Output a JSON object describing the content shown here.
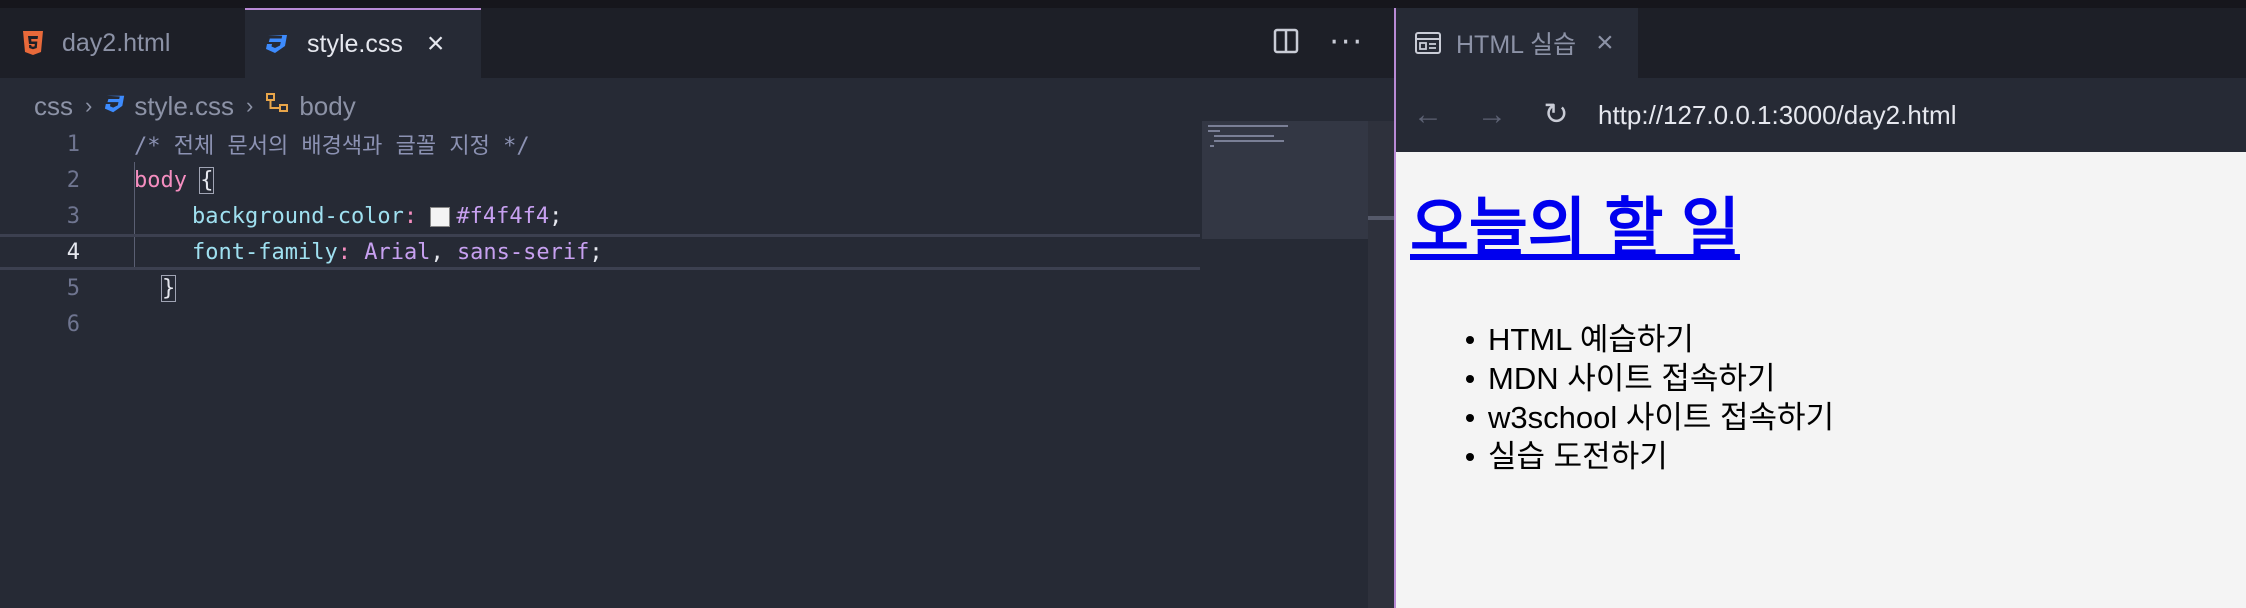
{
  "editor": {
    "tabs": [
      {
        "name": "day2.html",
        "icon": "html5-icon"
      },
      {
        "name": "style.css",
        "icon": "css3-icon",
        "active": true
      }
    ],
    "breadcrumb": [
      "css",
      "style.css",
      "body"
    ],
    "lines": {
      "n1": "1",
      "n2": "2",
      "n3": "3",
      "n4": "4",
      "n5": "5",
      "n6": "6",
      "comment": "/* 전체 문서의 배경색과 글꼴 지정 */",
      "selector": "body",
      "open_brace": "{",
      "prop1": "background-color",
      "val1": "#f4f4f4",
      "prop2": "font-family",
      "val2a": "Arial",
      "val2b": "sans-serif",
      "close_brace": "}"
    },
    "colors": {
      "accent": "#b98ad6",
      "swatch": "#f4f4f4"
    }
  },
  "browser": {
    "tab_title": "HTML 실습",
    "url": "http://127.0.0.1:3000/day2.html",
    "page": {
      "heading": "오늘의 할 일",
      "items": [
        "HTML 예습하기",
        "MDN 사이트 접속하기",
        "w3school 사이트 접속하기",
        "실습 도전하기"
      ]
    }
  }
}
